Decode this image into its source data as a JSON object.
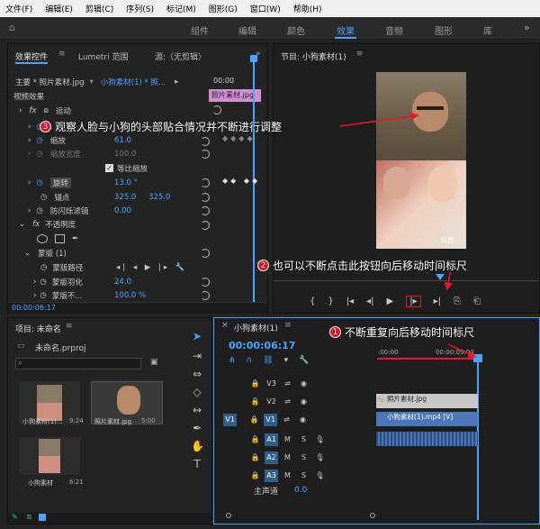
{
  "menu": [
    "文件(F)",
    "编辑(E)",
    "剪辑(C)",
    "序列(S)",
    "标记(M)",
    "图形(G)",
    "窗口(W)",
    "帮助(H)"
  ],
  "workspaces": [
    "组件",
    "编辑",
    "颜色",
    "效果",
    "音频",
    "图形",
    "库"
  ],
  "effect_controls": {
    "tabs": [
      "效果控件",
      "Lumetri 范围",
      "源:（无剪辑）"
    ],
    "master": "主要 * 照片素材.jpg",
    "sequence": "小狗素材(1) * 照...",
    "time": "00:00",
    "clip_label": "照片素材.jpg",
    "section": "视频效果",
    "motion": "运动",
    "scale_label": "缩放",
    "scale_value": "61.0",
    "scale_width_label": "缩放宽度",
    "scale_width_value": "100.0",
    "uniform_scale": "等比缩放",
    "rotation_label": "旋转",
    "rotation_value": "13.0 °",
    "anchor_label": "锚点",
    "anchor_x": "325.0",
    "anchor_y": "325.0",
    "flicker_label": "防闪烁滤镜",
    "flicker_value": "0.00",
    "opacity_label": "不透明度",
    "mask_label": "蒙版 (1)",
    "mask_path": "蒙版路径",
    "mask_feather": "蒙版羽化",
    "mask_feather_value": "24.0",
    "mask_opacity": "蒙版不...",
    "mask_opacity_value": "100.0 %",
    "timecode": "00:00:06:17"
  },
  "program": {
    "title": "节目: 小狗素材(1)",
    "watermark": "抖音"
  },
  "project": {
    "title": "项目: 未命名",
    "file": "未命名.prproj",
    "items": [
      {
        "name": "小狗素材(1)...",
        "dur": "9:24"
      },
      {
        "name": "照片素材.jpg",
        "dur": "5:00"
      },
      {
        "name": "小狗素材",
        "dur": "6:21"
      }
    ]
  },
  "timeline": {
    "tab": "小狗素材(1)",
    "timecode": "00:00:06:17",
    "ruler": [
      ":00:00",
      "00:00:05:00"
    ],
    "tracks_v": [
      "V3",
      "V2",
      "V1"
    ],
    "tracks_a": [
      "A1",
      "A2",
      "A3"
    ],
    "src_v": "V1",
    "master": "主声道",
    "master_value": "0.0",
    "clip_photo": "照片素材.jpg",
    "clip_video": "小狗素材(1).mp4 [V]"
  },
  "callouts": [
    {
      "n": "3",
      "text": "观察人脸与小狗的头部贴合情况并不断进行调整"
    },
    {
      "n": "2",
      "text": "也可以不断点击此按钮向后移动时间标尺"
    },
    {
      "n": "1",
      "text": "不断重复向后移动时间标尺"
    }
  ],
  "colors": {
    "accent": "#4aa3ff",
    "callout": "#e8192c",
    "clip_photo": "#c8c8c8",
    "clip_video": "#4b77b8",
    "label_pink": "#d38fd3"
  }
}
